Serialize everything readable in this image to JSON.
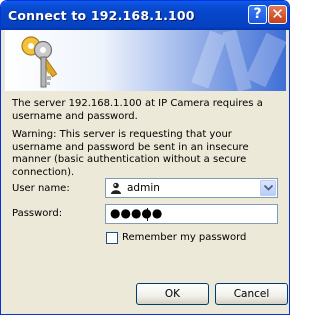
{
  "window": {
    "title": "Connect to 192.168.1.100",
    "help_label": "?",
    "close_label": "✕"
  },
  "message": {
    "intro": "The server 192.168.1.100 at IP Camera requires a username and password.",
    "warning": "Warning: This server is requesting that your username and password be sent in an insecure manner (basic authentication without a secure connection)."
  },
  "form": {
    "username_label": "User name:",
    "username_value": "admin",
    "password_label": "Password:",
    "password_mask": "●●●●●",
    "remember_label": "Remember my password",
    "remember_checked": false
  },
  "buttons": {
    "ok": "OK",
    "cancel": "Cancel"
  },
  "icons": [
    "keys-icon",
    "user-icon",
    "chevron-down-icon"
  ]
}
